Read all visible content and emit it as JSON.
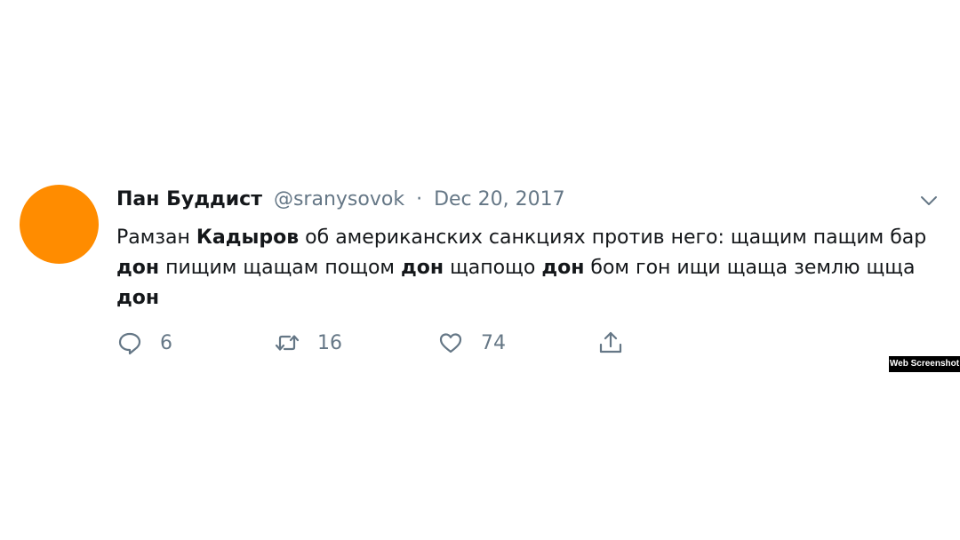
{
  "tweet": {
    "author_name": "Пан Буддист",
    "handle": "@sranysovok",
    "separator": "·",
    "date": "Dec 20, 2017",
    "text_segments": [
      {
        "text": "Рамзан ",
        "bold": false
      },
      {
        "text": "Кадыров",
        "bold": true
      },
      {
        "text": " об американских санкциях против него: щащим пащим бар ",
        "bold": false
      },
      {
        "text": "дон",
        "bold": true
      },
      {
        "text": " пищим щащам пощом ",
        "bold": false
      },
      {
        "text": "дон",
        "bold": true
      },
      {
        "text": " щапощо ",
        "bold": false
      },
      {
        "text": "дон",
        "bold": true
      },
      {
        "text": " бом гон ищи щаща землю щща ",
        "bold": false
      },
      {
        "text": "дон",
        "bold": true
      }
    ],
    "actions": {
      "reply_count": "6",
      "retweet_count": "16",
      "like_count": "74"
    }
  },
  "icons": {
    "avatar": "avatar",
    "menu": "chevron-down-icon",
    "reply": "reply-icon",
    "retweet": "retweet-icon",
    "like": "like-icon",
    "share": "share-icon"
  },
  "colors": {
    "avatar": "#ff8c00",
    "text": "#14171a",
    "secondary": "#657786",
    "badge_bg": "#000000",
    "badge_text": "#ffffff"
  },
  "watermark": {
    "label": "Web Screenshot"
  }
}
